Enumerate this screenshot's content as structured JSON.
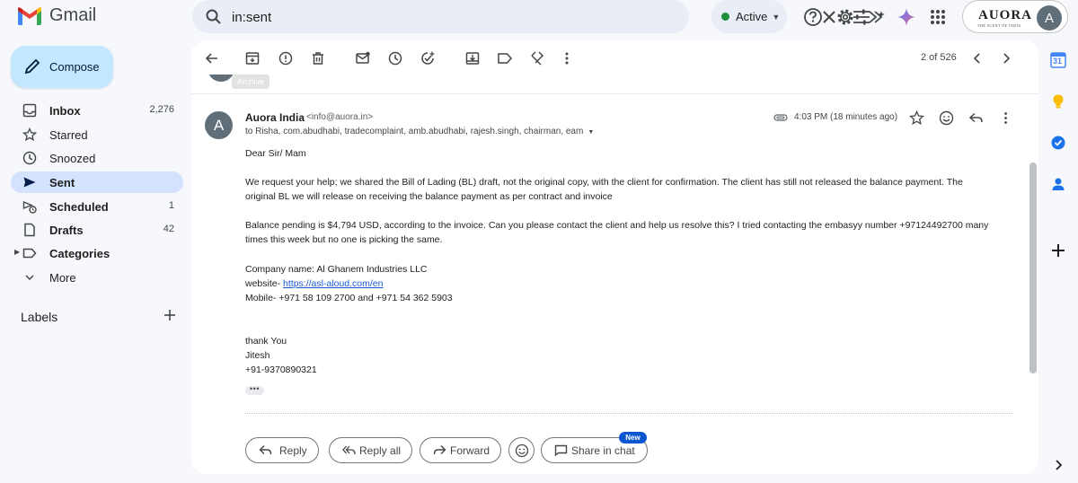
{
  "app": {
    "name": "Gmail"
  },
  "search": {
    "query": "in:sent"
  },
  "status": {
    "label": "Active",
    "color": "#1e8e3e"
  },
  "account": {
    "brand": "AUORA",
    "tagline": "THE SCENT OF INDIA",
    "avatar_initial": "A"
  },
  "compose": {
    "label": "Compose"
  },
  "nav": [
    {
      "label": "Inbox",
      "count": "2,276",
      "bold": true
    },
    {
      "label": "Starred",
      "count": "",
      "bold": false
    },
    {
      "label": "Snoozed",
      "count": "",
      "bold": false
    },
    {
      "label": "Sent",
      "count": "",
      "bold": true,
      "active": true
    },
    {
      "label": "Scheduled",
      "count": "1",
      "bold": true
    },
    {
      "label": "Drafts",
      "count": "42",
      "bold": true
    },
    {
      "label": "Categories",
      "count": "",
      "bold": true
    },
    {
      "label": "More",
      "count": "",
      "bold": false
    }
  ],
  "labels": {
    "heading": "Labels"
  },
  "toolbar": {
    "pager": "2 of 526",
    "archive_tip": "Archive"
  },
  "message": {
    "sender_initial": "A",
    "sender_name": "Auora India",
    "sender_email": "<info@auora.in>",
    "recipients": "to Risha, com.abudhabi, tradecomplaint, amb.abudhabi, rajesh.singh, chairman, eam",
    "time": "4:03 PM (18 minutes ago)",
    "greeting": "Dear Sir/ Mam",
    "para1_line1": "We request your help; we shared the Bill of Lading (BL) draft, not the original copy, with the client for confirmation. The client has still not released the balance payment. The",
    "para1_line2": "original BL we will release on receiving the balance payment as per contract and invoice",
    "para2_line1": "Balance pending is $4,794 USD, according to the invoice. Can you please contact the client and help us resolve this? I tried contacting the embasyy number +97124492700 many",
    "para2_line2": "times this week but no one is picking the same.",
    "company": "Company name: Al Ghanem Industries LLC",
    "website_label": "website- ",
    "website_url": "https://asl-aloud.com/en",
    "mobile": "Mobile- +971 58 109 2700 and +971 54 362 5903",
    "thanks": "thank You",
    "signature_name": "Jitesh",
    "signature_phone": "+91-9370890321",
    "dots": "•••"
  },
  "actions": {
    "reply": "Reply",
    "reply_all": "Reply all",
    "forward": "Forward",
    "share_chat": "Share in chat",
    "new_badge": "New"
  },
  "rail": {
    "calendar_day": "31"
  },
  "icons": [
    "search-icon",
    "close-icon",
    "tune-icon",
    "help-icon",
    "gear-icon",
    "gemini-icon",
    "apps-icon"
  ]
}
